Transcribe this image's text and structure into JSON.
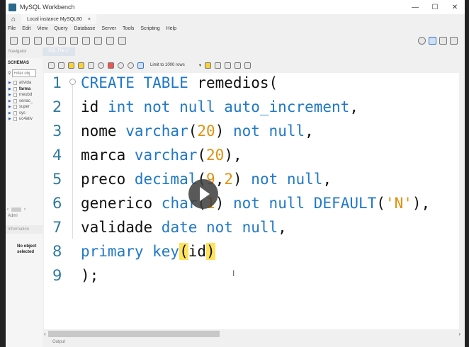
{
  "window": {
    "title": "MySQL Workbench",
    "controls": [
      "—",
      "☐",
      "✕"
    ]
  },
  "tab": {
    "home_icon": "⌂",
    "label": "Local instance MySQL80",
    "close": "×"
  },
  "menu": [
    "File",
    "Edit",
    "View",
    "Query",
    "Database",
    "Server",
    "Tools",
    "Scripting",
    "Help"
  ],
  "navigator": {
    "label": "Navigator",
    "sql_tab": "SQL File 1*",
    "schemas_label": "SCHEMAS",
    "filter_placeholder": "Filter obj",
    "schemas": [
      {
        "name": "ativida",
        "bold": false
      },
      {
        "name": "farma",
        "bold": true
      },
      {
        "name": "meubd",
        "bold": false
      },
      {
        "name": "senac_",
        "bold": false
      },
      {
        "name": "super",
        "bold": false
      },
      {
        "name": "sys",
        "bold": false
      },
      {
        "name": "uc4ativ",
        "bold": false
      }
    ],
    "admin_label": "Admi",
    "info_label": "Information",
    "no_object": "No object selected"
  },
  "editor_toolbar": {
    "limit_label": "Limit to 1000 rows",
    "limit_caret": "▾"
  },
  "editor": {
    "lines": [
      [
        [
          "CREATE TABLE",
          "kw"
        ],
        [
          " remedios(",
          ""
        ]
      ],
      [
        [
          "id ",
          ""
        ],
        [
          "int not null auto_increment",
          "kw"
        ],
        [
          ",",
          ""
        ]
      ],
      [
        [
          "nome ",
          ""
        ],
        [
          "varchar",
          "kw"
        ],
        [
          "(",
          ""
        ],
        [
          "20",
          "num"
        ],
        [
          ") ",
          ""
        ],
        [
          "not null",
          "kw"
        ],
        [
          ",",
          ""
        ]
      ],
      [
        [
          "marca ",
          ""
        ],
        [
          "varchar",
          "kw"
        ],
        [
          "(",
          ""
        ],
        [
          "20",
          "num"
        ],
        [
          "),",
          ""
        ]
      ],
      [
        [
          "preco ",
          ""
        ],
        [
          "decimal",
          "kw"
        ],
        [
          "(",
          ""
        ],
        [
          "9",
          "num"
        ],
        [
          ",",
          ""
        ],
        [
          "2",
          "num"
        ],
        [
          ") ",
          ""
        ],
        [
          "not null",
          "kw"
        ],
        [
          ",",
          ""
        ]
      ],
      [
        [
          "generico ",
          ""
        ],
        [
          "char",
          "kw"
        ],
        [
          "(",
          ""
        ],
        [
          "1",
          "num"
        ],
        [
          ") ",
          ""
        ],
        [
          "not null DEFAULT",
          "kw"
        ],
        [
          "(",
          ""
        ],
        [
          "'N'",
          "str"
        ],
        [
          "),",
          ""
        ]
      ],
      [
        [
          "validade ",
          ""
        ],
        [
          "date not null",
          "kw"
        ],
        [
          ",",
          ""
        ]
      ],
      [
        [
          "primary key",
          "kw"
        ],
        [
          "(",
          "br"
        ],
        [
          "id",
          ""
        ],
        [
          ")",
          "br"
        ]
      ],
      [
        [
          ");",
          ""
        ]
      ]
    ]
  },
  "scrollbar": {
    "left": "‹",
    "right": "›"
  },
  "output": {
    "label": "Output"
  }
}
